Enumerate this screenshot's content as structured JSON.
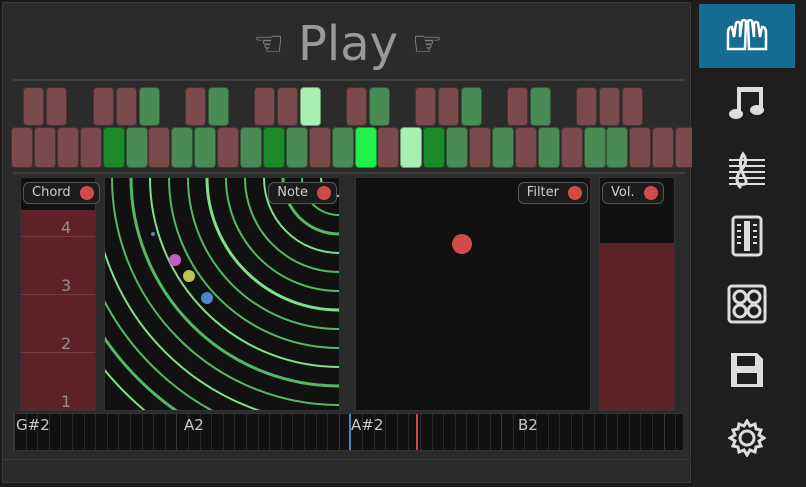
{
  "header": {
    "title": "Play"
  },
  "panels": {
    "chord": {
      "label": "Chord",
      "numbers": [
        "4",
        "3",
        "2",
        "1"
      ],
      "level": 0.86
    },
    "note": {
      "label": "Note"
    },
    "filter": {
      "label": "Filter"
    },
    "volume": {
      "label": "Vol.",
      "level": 0.72
    }
  },
  "notes_bar": {
    "labels": [
      "G#2",
      "A2",
      "A#2",
      "B2"
    ]
  },
  "sidebar": {
    "items": [
      {
        "name": "play-hands-icon",
        "active": true
      },
      {
        "name": "music-note-icon",
        "active": false
      },
      {
        "name": "sheet-music-icon",
        "active": false
      },
      {
        "name": "sequencer-icon",
        "active": false
      },
      {
        "name": "pads-icon",
        "active": false
      },
      {
        "name": "save-icon",
        "active": false
      },
      {
        "name": "settings-gear-icon",
        "active": false
      }
    ]
  },
  "colors": {
    "accent": "#176c94",
    "key_off": "#7a4a4d",
    "key_green": "#4a8a55",
    "key_bright": "#1ff04a",
    "key_pale": "#a8f0b0"
  }
}
